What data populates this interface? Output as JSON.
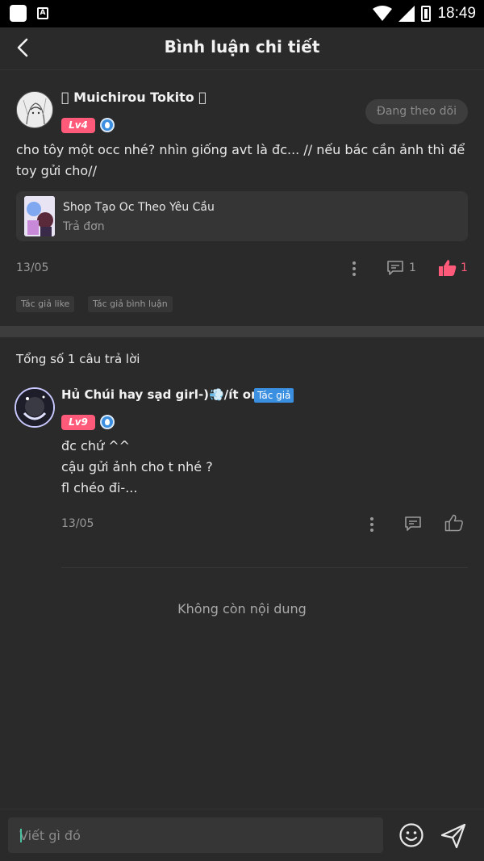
{
  "status_bar": {
    "time": "18:49",
    "notif_icon_letter": "A"
  },
  "header": {
    "title": "Bình luận chi tiết",
    "back_icon": "chevron-left-icon"
  },
  "main_comment": {
    "username": "\u0000 Muichirou Tokito \u0000",
    "level": "Lv4",
    "follow_label": "Đang theo dõi",
    "text": "cho tôy một occ nhé? nhìn giống avt là đc... // nếu bác cần ảnh thì để toy gửi cho//",
    "shop": {
      "name": "Shop Tạo Oc Theo Yêu Cầu",
      "sub": "Trả đơn"
    },
    "date": "13/05",
    "reply_count": "1",
    "like_count": "1",
    "tags": [
      "Tác giả like",
      "Tác giả bình luận"
    ]
  },
  "replies_section": {
    "total_label": "Tổng số 1 câu trả lời",
    "replies": [
      {
        "username": "Hủ Chúi hay sạd girl-)💨/ít on",
        "author_badge": "Tác giả",
        "level": "Lv9",
        "lines": [
          "đc chứ ^^",
          "cậu gửi ảnh cho t nhé ?",
          "fl chéo đi-..."
        ],
        "date": "13/05"
      }
    ],
    "end_label": "Không còn nội dung"
  },
  "input_bar": {
    "placeholder": "Viết gì đó",
    "emoji_icon": "smiley-icon",
    "send_icon": "send-icon"
  },
  "colors": {
    "background": "#2a2a2a",
    "accent_pink": "#ff5a79",
    "accent_blue": "#3a8fe0"
  }
}
